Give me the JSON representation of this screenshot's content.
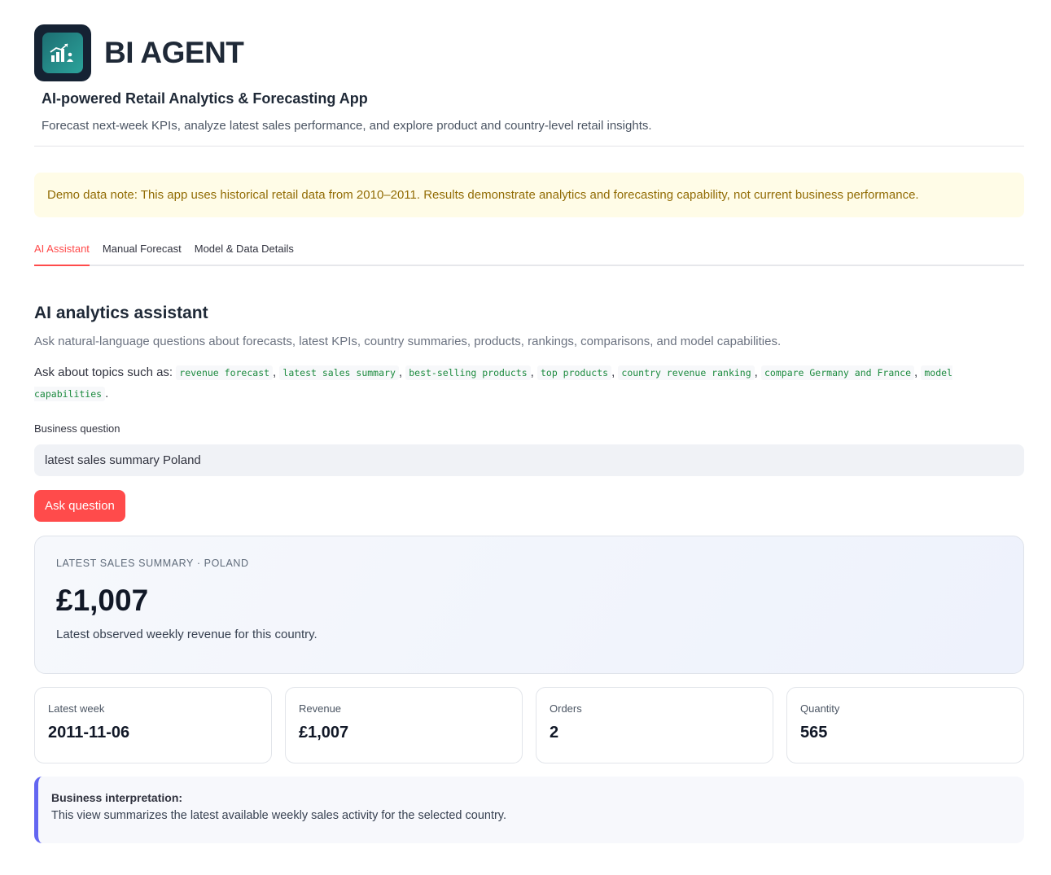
{
  "header": {
    "title": "BI AGENT",
    "subtitle": "AI-powered Retail Analytics & Forecasting App",
    "description": "Forecast next-week KPIs, analyze latest sales performance, and explore product and country-level retail insights."
  },
  "note": "Demo data note: This app uses historical retail data from 2010–2011. Results demonstrate analytics and forecasting capability, not current business performance.",
  "tabs": [
    {
      "label": "AI Assistant",
      "active": true
    },
    {
      "label": "Manual Forecast",
      "active": false
    },
    {
      "label": "Model & Data Details",
      "active": false
    }
  ],
  "assistant": {
    "title": "AI analytics assistant",
    "description": "Ask natural-language questions about forecasts, latest KPIs, country summaries, products, rankings, comparisons, and model capabilities.",
    "topics_prefix": "Ask about topics such as:",
    "topics": [
      "revenue forecast",
      "latest sales summary",
      "best-selling products",
      "top products",
      "country revenue ranking",
      "compare Germany and France",
      "model capabilities"
    ],
    "question_label": "Business question",
    "question_value": "latest sales summary Poland",
    "ask_button": "Ask question"
  },
  "summary": {
    "kicker": "LATEST SALES SUMMARY · POLAND",
    "value": "£1,007",
    "caption": "Latest observed weekly revenue for this country."
  },
  "metrics": [
    {
      "label": "Latest week",
      "value": "2011-11-06"
    },
    {
      "label": "Revenue",
      "value": "£1,007"
    },
    {
      "label": "Orders",
      "value": "2"
    },
    {
      "label": "Quantity",
      "value": "565"
    }
  ],
  "interpretation": {
    "title": "Business interpretation:",
    "text": "This view summarizes the latest available weekly sales activity for the selected country."
  },
  "colors": {
    "accent": "#ff4b4b",
    "note_bg": "#fffce7",
    "note_text": "#926c05",
    "interp_border": "#6366f1"
  }
}
